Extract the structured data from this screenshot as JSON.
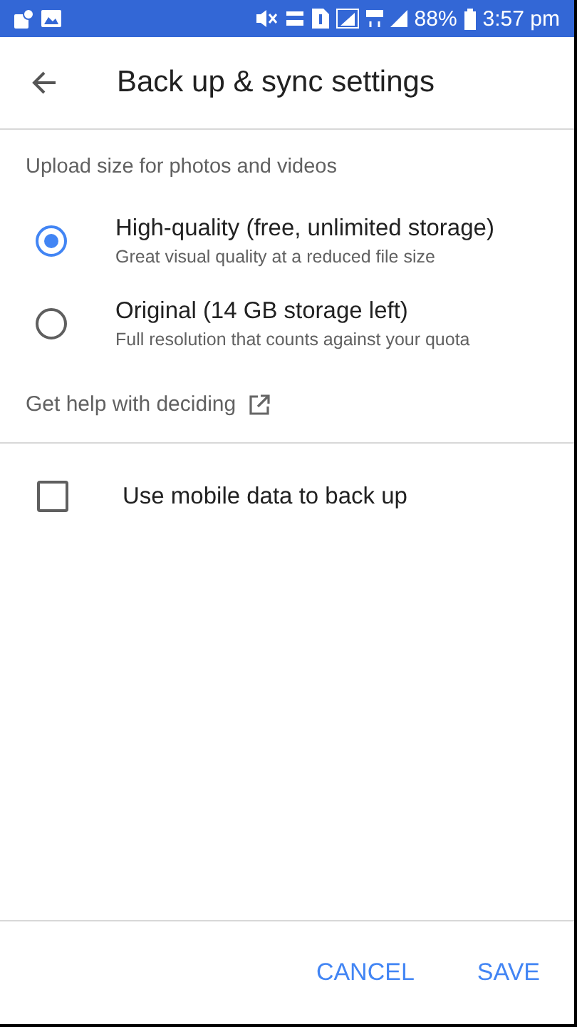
{
  "status_bar": {
    "battery": "88%",
    "time": "3:57 pm"
  },
  "header": {
    "title": "Back up & sync settings"
  },
  "upload_section": {
    "label": "Upload size for photos and videos",
    "options": [
      {
        "title": "High-quality (free, unlimited storage)",
        "subtitle": "Great visual quality at a reduced file size",
        "selected": true
      },
      {
        "title": "Original (14 GB storage left)",
        "subtitle": "Full resolution that counts against your quota",
        "selected": false
      }
    ],
    "help_link": "Get help with deciding"
  },
  "mobile_data": {
    "label": "Use mobile data to back up",
    "checked": false
  },
  "buttons": [
    "CANCEL",
    "SAVE"
  ]
}
